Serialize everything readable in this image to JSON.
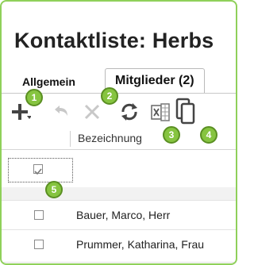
{
  "window": {
    "title": "Kontaktliste: Herbs"
  },
  "tabs": [
    {
      "label": "Allgemein",
      "active": false
    },
    {
      "label": "Mitglieder (2)",
      "active": true
    }
  ],
  "toolbar": {
    "buttons": [
      {
        "icon": "plus-icon",
        "enabled": true
      },
      {
        "icon": "undo-icon",
        "enabled": false
      },
      {
        "icon": "delete-x-icon",
        "enabled": false
      },
      {
        "icon": "refresh-icon",
        "enabled": true
      },
      {
        "icon": "excel-export-icon",
        "enabled": true
      },
      {
        "icon": "copy-icon",
        "enabled": true
      }
    ]
  },
  "table": {
    "columns": [
      "Bezeichnung"
    ],
    "rows": [
      {
        "checked": true,
        "name": ""
      },
      {
        "checked": false,
        "name": "Bauer, Marco, Herr"
      },
      {
        "checked": false,
        "name": "Prummer, Katharina, Frau"
      }
    ]
  },
  "annotations": [
    "1",
    "2",
    "3",
    "4",
    "5"
  ],
  "colors": {
    "accent_green": "#86c440",
    "frame_green": "#8fd05a"
  }
}
